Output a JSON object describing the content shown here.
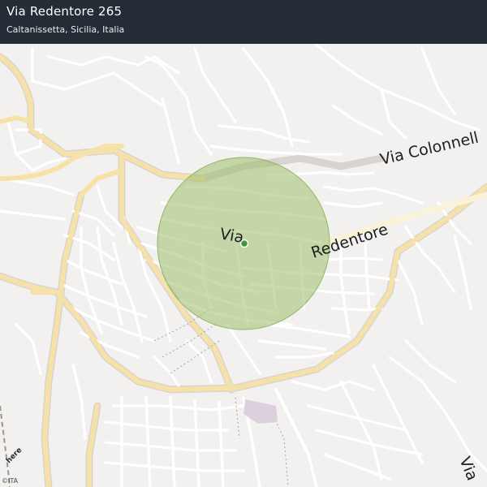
{
  "header": {
    "title": "Via Redentore 265",
    "subtitle": "Caltanissetta, Sicilia, Italia"
  },
  "map": {
    "labels": {
      "via_center": "Via",
      "redentore": "Redentore",
      "via_colonnello": "Via Colonnell",
      "via_bottom": "Via"
    },
    "radius_colour": "#9cc06d",
    "marker_colour": "#3a9a3a",
    "major_road_colour": "#f6e2a8",
    "minor_road_colour": "#ffffff",
    "background_colour": "#f3f1ef",
    "poi_colour": "#dcd0dc"
  },
  "attribution": {
    "logo": "here",
    "copyright": "©ITA"
  }
}
